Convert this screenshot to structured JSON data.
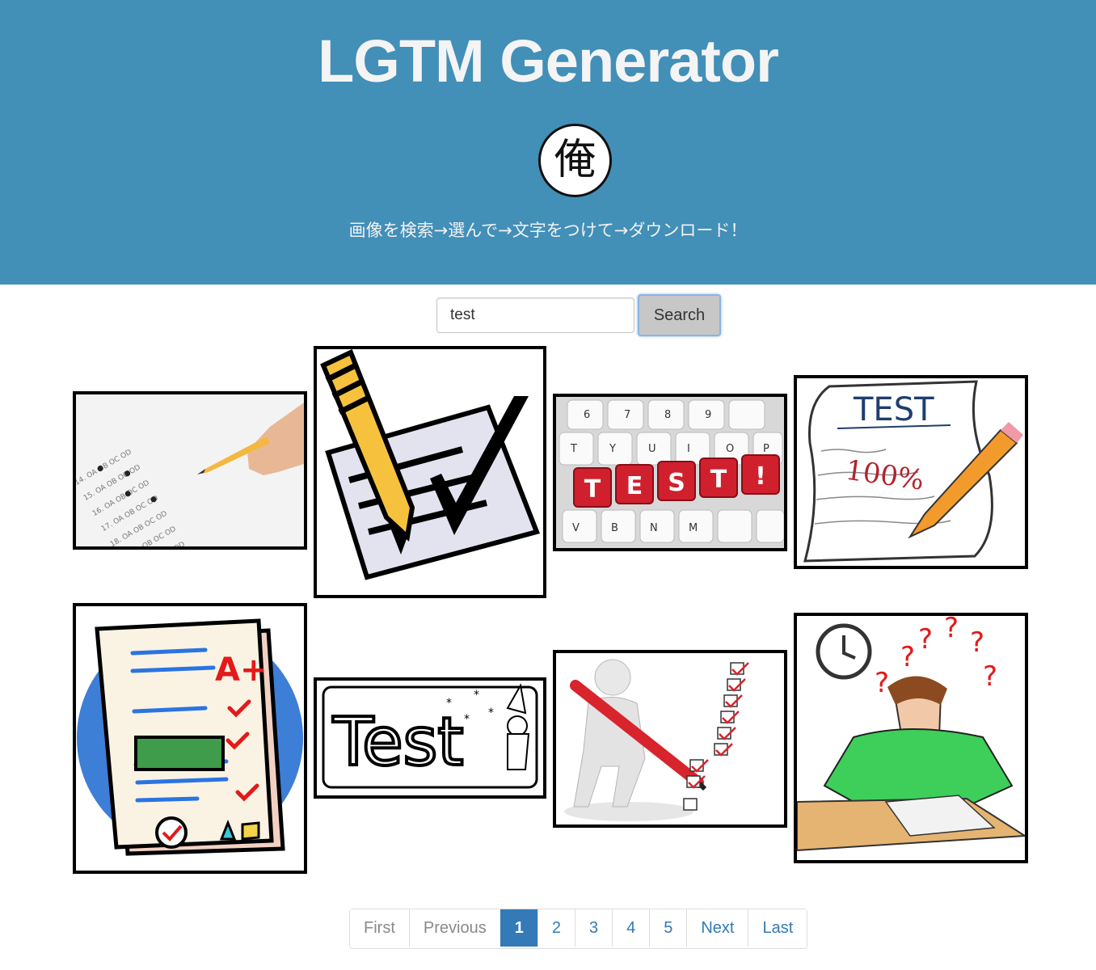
{
  "header": {
    "title": "LGTM Generator",
    "logo_char": "俺",
    "tagline": "画像を検索→選んで→文字をつけて→ダウンロード！",
    "bg_color": "#428fb8"
  },
  "search": {
    "value": "test",
    "button_label": "Search"
  },
  "results": {
    "image_1": {
      "subject": "answer sheet with pencil"
    },
    "image_2": {
      "subject": "pencil with checkmark"
    },
    "image_3": {
      "key_letters": [
        "T",
        "E",
        "S",
        "T",
        "!"
      ],
      "row_top": [
        "6",
        "7",
        "8",
        "9"
      ],
      "row_mid": [
        "T",
        "Y",
        "U",
        "I",
        "O",
        "P"
      ],
      "row_bottom": [
        "V",
        "B",
        "N",
        "M"
      ]
    },
    "image_4": {
      "title": "TEST",
      "score": "100%"
    },
    "image_5": {
      "grade": "A+"
    },
    "image_6": {
      "word": "Test"
    },
    "image_7": {
      "subject": "figure with pen and checklist"
    },
    "image_8": {
      "subject": "student thinking with question marks"
    }
  },
  "pagination": {
    "first": "First",
    "previous": "Previous",
    "pages": [
      "1",
      "2",
      "3",
      "4",
      "5"
    ],
    "active_page": "1",
    "next": "Next",
    "last": "Last",
    "accent_color": "#337ab7"
  }
}
